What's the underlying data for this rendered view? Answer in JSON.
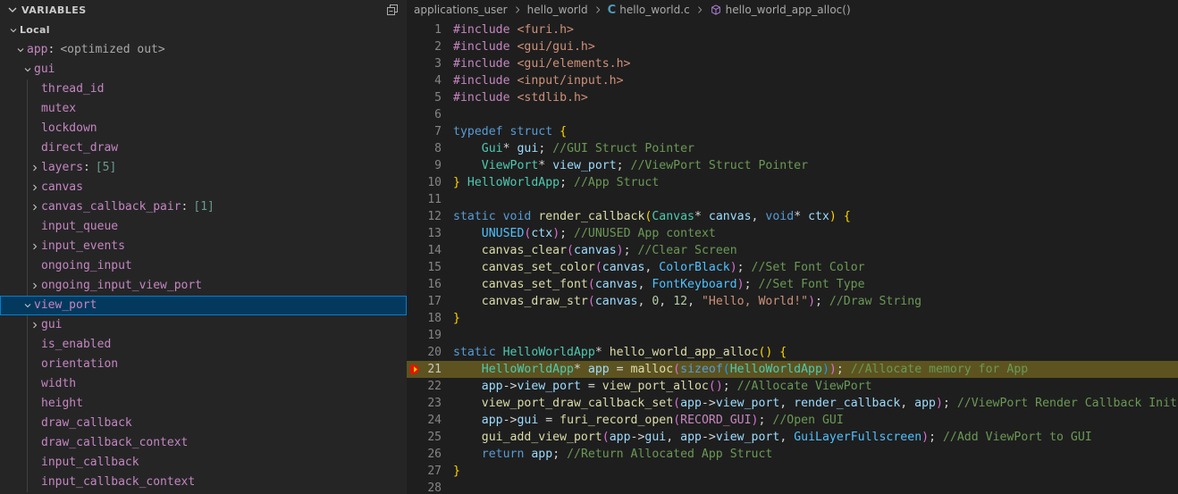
{
  "sidebar": {
    "title": "VARIABLES",
    "collapse_all_tooltip": "Collapse All",
    "scope": "Local",
    "tree": [
      {
        "label": "Local",
        "depth": 0,
        "twisty": "down",
        "kind": "scope"
      },
      {
        "label": "app",
        "depth": 1,
        "twisty": "down",
        "sep": ":",
        "value": "<optimized out>"
      },
      {
        "label": "gui",
        "depth": 2,
        "twisty": "down"
      },
      {
        "label": "thread_id",
        "depth": 3,
        "twisty": "none"
      },
      {
        "label": "mutex",
        "depth": 3,
        "twisty": "none"
      },
      {
        "label": "lockdown",
        "depth": 3,
        "twisty": "none"
      },
      {
        "label": "direct_draw",
        "depth": 3,
        "twisty": "none"
      },
      {
        "label": "layers",
        "depth": 3,
        "twisty": "right",
        "sep": ":",
        "value": "[5]"
      },
      {
        "label": "canvas",
        "depth": 3,
        "twisty": "right"
      },
      {
        "label": "canvas_callback_pair",
        "depth": 3,
        "twisty": "right",
        "sep": ":",
        "value": "[1]"
      },
      {
        "label": "input_queue",
        "depth": 3,
        "twisty": "none"
      },
      {
        "label": "input_events",
        "depth": 3,
        "twisty": "right"
      },
      {
        "label": "ongoing_input",
        "depth": 3,
        "twisty": "none"
      },
      {
        "label": "ongoing_input_view_port",
        "depth": 3,
        "twisty": "right"
      },
      {
        "label": "view_port",
        "depth": 2,
        "twisty": "down",
        "selected": true
      },
      {
        "label": "gui",
        "depth": 3,
        "twisty": "right"
      },
      {
        "label": "is_enabled",
        "depth": 3,
        "twisty": "none"
      },
      {
        "label": "orientation",
        "depth": 3,
        "twisty": "none"
      },
      {
        "label": "width",
        "depth": 3,
        "twisty": "none"
      },
      {
        "label": "height",
        "depth": 3,
        "twisty": "none"
      },
      {
        "label": "draw_callback",
        "depth": 3,
        "twisty": "none"
      },
      {
        "label": "draw_callback_context",
        "depth": 3,
        "twisty": "none"
      },
      {
        "label": "input_callback",
        "depth": 3,
        "twisty": "none"
      },
      {
        "label": "input_callback_context",
        "depth": 3,
        "twisty": "none"
      }
    ]
  },
  "breadcrumb": [
    {
      "label": "applications_user",
      "icon": null
    },
    {
      "label": "hello_world",
      "icon": null
    },
    {
      "label": "hello_world.c",
      "icon": "c-file-icon"
    },
    {
      "label": "hello_world_app_alloc()",
      "icon": "function-symbol-icon"
    }
  ],
  "editor": {
    "current_line": 21,
    "debug_marker": "debug-current-statement-icon",
    "lines": [
      {
        "n": 1,
        "tokens": [
          {
            "t": "#include ",
            "c": "t-pp"
          },
          {
            "t": "<furi.h>",
            "c": "t-str"
          }
        ]
      },
      {
        "n": 2,
        "tokens": [
          {
            "t": "#include ",
            "c": "t-pp"
          },
          {
            "t": "<gui/gui.h>",
            "c": "t-str"
          }
        ]
      },
      {
        "n": 3,
        "tokens": [
          {
            "t": "#include ",
            "c": "t-pp"
          },
          {
            "t": "<gui/elements.h>",
            "c": "t-str"
          }
        ]
      },
      {
        "n": 4,
        "tokens": [
          {
            "t": "#include ",
            "c": "t-pp"
          },
          {
            "t": "<input/input.h>",
            "c": "t-str"
          }
        ]
      },
      {
        "n": 5,
        "tokens": [
          {
            "t": "#include ",
            "c": "t-pp"
          },
          {
            "t": "<stdlib.h>",
            "c": "t-str"
          }
        ]
      },
      {
        "n": 6,
        "tokens": []
      },
      {
        "n": 7,
        "tokens": [
          {
            "t": "typedef",
            "c": "t-kw"
          },
          {
            "t": " ",
            "c": "t-plain"
          },
          {
            "t": "struct",
            "c": "t-kw"
          },
          {
            "t": " ",
            "c": "t-plain"
          },
          {
            "t": "{",
            "c": "t-p1"
          }
        ]
      },
      {
        "n": 8,
        "tokens": [
          {
            "t": "    ",
            "c": "t-plain"
          },
          {
            "t": "Gui",
            "c": "t-type"
          },
          {
            "t": "* ",
            "c": "t-op"
          },
          {
            "t": "gui",
            "c": "t-var"
          },
          {
            "t": ";",
            "c": "t-plain"
          },
          {
            "t": " //GUI Struct Pointer",
            "c": "t-cmt"
          }
        ]
      },
      {
        "n": 9,
        "tokens": [
          {
            "t": "    ",
            "c": "t-plain"
          },
          {
            "t": "ViewPort",
            "c": "t-type"
          },
          {
            "t": "* ",
            "c": "t-op"
          },
          {
            "t": "view_port",
            "c": "t-var"
          },
          {
            "t": ";",
            "c": "t-plain"
          },
          {
            "t": " //ViewPort Struct Pointer",
            "c": "t-cmt"
          }
        ]
      },
      {
        "n": 10,
        "tokens": [
          {
            "t": "}",
            "c": "t-p1"
          },
          {
            "t": " ",
            "c": "t-plain"
          },
          {
            "t": "HelloWorldApp",
            "c": "t-type"
          },
          {
            "t": ";",
            "c": "t-plain"
          },
          {
            "t": " //App Struct",
            "c": "t-cmt"
          }
        ]
      },
      {
        "n": 11,
        "tokens": []
      },
      {
        "n": 12,
        "tokens": [
          {
            "t": "static",
            "c": "t-kw"
          },
          {
            "t": " ",
            "c": "t-plain"
          },
          {
            "t": "void",
            "c": "t-kw"
          },
          {
            "t": " ",
            "c": "t-plain"
          },
          {
            "t": "render_callback",
            "c": "t-fn"
          },
          {
            "t": "(",
            "c": "t-p1"
          },
          {
            "t": "Canvas",
            "c": "t-type"
          },
          {
            "t": "* ",
            "c": "t-op"
          },
          {
            "t": "canvas",
            "c": "t-var"
          },
          {
            "t": ", ",
            "c": "t-plain"
          },
          {
            "t": "void",
            "c": "t-kw"
          },
          {
            "t": "* ",
            "c": "t-op"
          },
          {
            "t": "ctx",
            "c": "t-var"
          },
          {
            "t": ")",
            "c": "t-p1"
          },
          {
            "t": " ",
            "c": "t-plain"
          },
          {
            "t": "{",
            "c": "t-p1"
          }
        ]
      },
      {
        "n": 13,
        "tokens": [
          {
            "t": "    ",
            "c": "t-plain"
          },
          {
            "t": "UNUSED",
            "c": "t-const"
          },
          {
            "t": "(",
            "c": "t-p2"
          },
          {
            "t": "ctx",
            "c": "t-var"
          },
          {
            "t": ")",
            "c": "t-p2"
          },
          {
            "t": ";",
            "c": "t-plain"
          },
          {
            "t": " //UNUSED App context",
            "c": "t-cmt"
          }
        ]
      },
      {
        "n": 14,
        "tokens": [
          {
            "t": "    ",
            "c": "t-plain"
          },
          {
            "t": "canvas_clear",
            "c": "t-fn"
          },
          {
            "t": "(",
            "c": "t-p2"
          },
          {
            "t": "canvas",
            "c": "t-var"
          },
          {
            "t": ")",
            "c": "t-p2"
          },
          {
            "t": ";",
            "c": "t-plain"
          },
          {
            "t": " //Clear Screen",
            "c": "t-cmt"
          }
        ]
      },
      {
        "n": 15,
        "tokens": [
          {
            "t": "    ",
            "c": "t-plain"
          },
          {
            "t": "canvas_set_color",
            "c": "t-fn"
          },
          {
            "t": "(",
            "c": "t-p2"
          },
          {
            "t": "canvas",
            "c": "t-var"
          },
          {
            "t": ", ",
            "c": "t-plain"
          },
          {
            "t": "ColorBlack",
            "c": "t-const"
          },
          {
            "t": ")",
            "c": "t-p2"
          },
          {
            "t": ";",
            "c": "t-plain"
          },
          {
            "t": " //Set Font Color",
            "c": "t-cmt"
          }
        ]
      },
      {
        "n": 16,
        "tokens": [
          {
            "t": "    ",
            "c": "t-plain"
          },
          {
            "t": "canvas_set_font",
            "c": "t-fn"
          },
          {
            "t": "(",
            "c": "t-p2"
          },
          {
            "t": "canvas",
            "c": "t-var"
          },
          {
            "t": ", ",
            "c": "t-plain"
          },
          {
            "t": "FontKeyboard",
            "c": "t-const"
          },
          {
            "t": ")",
            "c": "t-p2"
          },
          {
            "t": ";",
            "c": "t-plain"
          },
          {
            "t": " //Set Font Type",
            "c": "t-cmt"
          }
        ]
      },
      {
        "n": 17,
        "tokens": [
          {
            "t": "    ",
            "c": "t-plain"
          },
          {
            "t": "canvas_draw_str",
            "c": "t-fn"
          },
          {
            "t": "(",
            "c": "t-p2"
          },
          {
            "t": "canvas",
            "c": "t-var"
          },
          {
            "t": ", ",
            "c": "t-plain"
          },
          {
            "t": "0",
            "c": "t-num"
          },
          {
            "t": ", ",
            "c": "t-plain"
          },
          {
            "t": "12",
            "c": "t-num"
          },
          {
            "t": ", ",
            "c": "t-plain"
          },
          {
            "t": "\"Hello, World!\"",
            "c": "t-str"
          },
          {
            "t": ")",
            "c": "t-p2"
          },
          {
            "t": ";",
            "c": "t-plain"
          },
          {
            "t": " //Draw String",
            "c": "t-cmt"
          }
        ]
      },
      {
        "n": 18,
        "tokens": [
          {
            "t": "}",
            "c": "t-p1"
          }
        ]
      },
      {
        "n": 19,
        "tokens": []
      },
      {
        "n": 20,
        "tokens": [
          {
            "t": "static",
            "c": "t-kw"
          },
          {
            "t": " ",
            "c": "t-plain"
          },
          {
            "t": "HelloWorldApp",
            "c": "t-type"
          },
          {
            "t": "* ",
            "c": "t-op"
          },
          {
            "t": "hello_world_app_alloc",
            "c": "t-fn"
          },
          {
            "t": "(",
            "c": "t-p1"
          },
          {
            "t": ")",
            "c": "t-p1"
          },
          {
            "t": " ",
            "c": "t-plain"
          },
          {
            "t": "{",
            "c": "t-p1"
          }
        ]
      },
      {
        "n": 21,
        "current": true,
        "tokens": [
          {
            "t": "    ",
            "c": "t-plain"
          },
          {
            "t": "HelloWorldApp",
            "c": "t-type"
          },
          {
            "t": "* ",
            "c": "t-op"
          },
          {
            "t": "app",
            "c": "t-var"
          },
          {
            "t": " = ",
            "c": "t-plain"
          },
          {
            "t": "malloc",
            "c": "t-fn"
          },
          {
            "t": "(",
            "c": "t-p2"
          },
          {
            "t": "sizeof",
            "c": "t-kw"
          },
          {
            "t": "(",
            "c": "t-p3"
          },
          {
            "t": "HelloWorldApp",
            "c": "t-type"
          },
          {
            "t": ")",
            "c": "t-p3"
          },
          {
            "t": ")",
            "c": "t-p2"
          },
          {
            "t": ";",
            "c": "t-plain"
          },
          {
            "t": " //Allocate memory for App",
            "c": "t-cmt"
          }
        ]
      },
      {
        "n": 22,
        "tokens": [
          {
            "t": "    ",
            "c": "t-plain"
          },
          {
            "t": "app",
            "c": "t-var"
          },
          {
            "t": "->",
            "c": "t-op"
          },
          {
            "t": "view_port",
            "c": "t-var"
          },
          {
            "t": " = ",
            "c": "t-plain"
          },
          {
            "t": "view_port_alloc",
            "c": "t-fn"
          },
          {
            "t": "(",
            "c": "t-p2"
          },
          {
            "t": ")",
            "c": "t-p2"
          },
          {
            "t": ";",
            "c": "t-plain"
          },
          {
            "t": " //Allocate ViewPort",
            "c": "t-cmt"
          }
        ]
      },
      {
        "n": 23,
        "tokens": [
          {
            "t": "    ",
            "c": "t-plain"
          },
          {
            "t": "view_port_draw_callback_set",
            "c": "t-fn"
          },
          {
            "t": "(",
            "c": "t-p2"
          },
          {
            "t": "app",
            "c": "t-var"
          },
          {
            "t": "->",
            "c": "t-op"
          },
          {
            "t": "view_port",
            "c": "t-var"
          },
          {
            "t": ", ",
            "c": "t-plain"
          },
          {
            "t": "render_callback",
            "c": "t-var"
          },
          {
            "t": ", ",
            "c": "t-plain"
          },
          {
            "t": "app",
            "c": "t-var"
          },
          {
            "t": ")",
            "c": "t-p2"
          },
          {
            "t": ";",
            "c": "t-plain"
          },
          {
            "t": " //ViewPort Render Callback Init",
            "c": "t-cmt"
          }
        ]
      },
      {
        "n": 24,
        "tokens": [
          {
            "t": "    ",
            "c": "t-plain"
          },
          {
            "t": "app",
            "c": "t-var"
          },
          {
            "t": "->",
            "c": "t-op"
          },
          {
            "t": "gui",
            "c": "t-var"
          },
          {
            "t": " = ",
            "c": "t-plain"
          },
          {
            "t": "furi_record_open",
            "c": "t-fn"
          },
          {
            "t": "(",
            "c": "t-p2"
          },
          {
            "t": "RECORD_GUI",
            "c": "t-macro"
          },
          {
            "t": ")",
            "c": "t-p2"
          },
          {
            "t": ";",
            "c": "t-plain"
          },
          {
            "t": " //Open GUI",
            "c": "t-cmt"
          }
        ]
      },
      {
        "n": 25,
        "tokens": [
          {
            "t": "    ",
            "c": "t-plain"
          },
          {
            "t": "gui_add_view_port",
            "c": "t-fn"
          },
          {
            "t": "(",
            "c": "t-p2"
          },
          {
            "t": "app",
            "c": "t-var"
          },
          {
            "t": "->",
            "c": "t-op"
          },
          {
            "t": "gui",
            "c": "t-var"
          },
          {
            "t": ", ",
            "c": "t-plain"
          },
          {
            "t": "app",
            "c": "t-var"
          },
          {
            "t": "->",
            "c": "t-op"
          },
          {
            "t": "view_port",
            "c": "t-var"
          },
          {
            "t": ", ",
            "c": "t-plain"
          },
          {
            "t": "GuiLayerFullscreen",
            "c": "t-const"
          },
          {
            "t": ")",
            "c": "t-p2"
          },
          {
            "t": ";",
            "c": "t-plain"
          },
          {
            "t": " //Add ViewPort to GUI",
            "c": "t-cmt"
          }
        ]
      },
      {
        "n": 26,
        "tokens": [
          {
            "t": "    ",
            "c": "t-plain"
          },
          {
            "t": "return",
            "c": "t-kw"
          },
          {
            "t": " ",
            "c": "t-plain"
          },
          {
            "t": "app",
            "c": "t-var"
          },
          {
            "t": ";",
            "c": "t-plain"
          },
          {
            "t": " //Return Allocated App Struct",
            "c": "t-cmt"
          }
        ]
      },
      {
        "n": 27,
        "tokens": [
          {
            "t": "}",
            "c": "t-p1"
          }
        ]
      },
      {
        "n": 28,
        "tokens": []
      }
    ]
  },
  "colors": {
    "editor_bg": "#1e1e1e",
    "sidebar_bg": "#252526",
    "selection_bg": "#04395e",
    "selection_border": "#007fd4",
    "current_line_bg": "#5c5320",
    "comment": "#6a9955",
    "keyword": "#569cd6",
    "type": "#4ec9b0",
    "function": "#dcdcaa",
    "variable": "#9cdcfe",
    "string": "#ce9178",
    "preprocessor": "#c586c0"
  }
}
